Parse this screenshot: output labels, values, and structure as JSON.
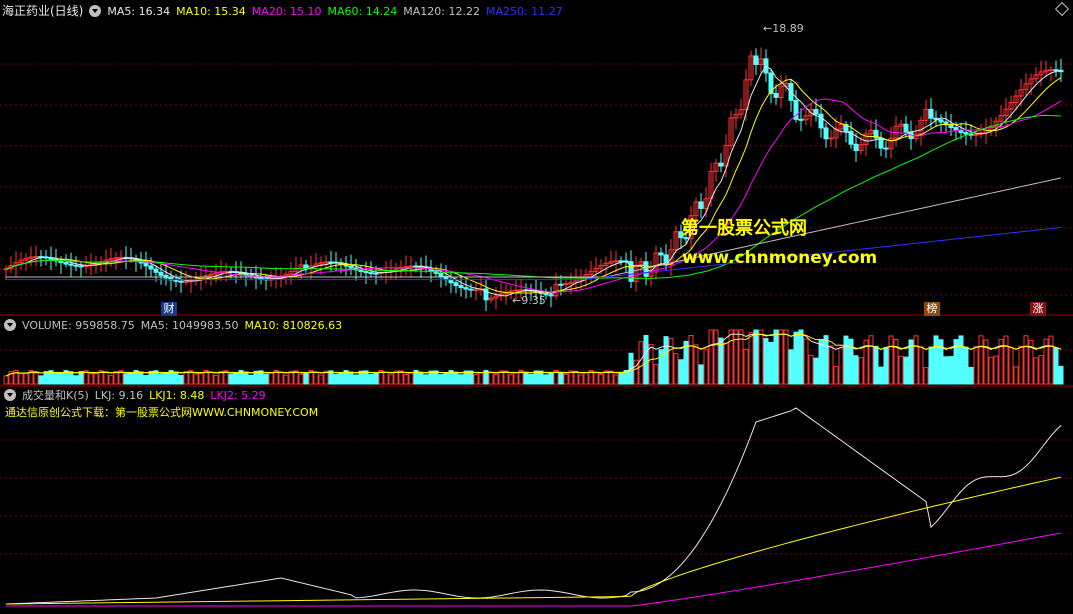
{
  "main_panel": {
    "title": "海正药业(日线)",
    "indicators": [
      {
        "label": "MA5: 16.34",
        "color": "#e8e8e8"
      },
      {
        "label": "MA10: 15.34",
        "color": "#ffff00"
      },
      {
        "label": "MA20: 15.10",
        "color": "#ff00ff"
      },
      {
        "label": "MA60: 14.24",
        "color": "#00ff00"
      },
      {
        "label": "MA120: 12.22",
        "color": "#c0c0c0"
      },
      {
        "label": "MA250: 11.27",
        "color": "#3030ff"
      }
    ],
    "high_label": "18.89",
    "low_label": "9.35",
    "watermark_cn": "第一股票公式网",
    "watermark_url": "www.chnmoney.com",
    "badges": [
      "财",
      "榜",
      "涨"
    ]
  },
  "volume_panel": {
    "indicators": [
      {
        "label": "VOLUME: 959858.75",
        "color": "#c0c0c0"
      },
      {
        "label": "MA5: 1049983.50",
        "color": "#c0c0c0"
      },
      {
        "label": "MA10: 810826.63",
        "color": "#ffff00"
      }
    ]
  },
  "indicator_panel": {
    "indicators": [
      {
        "label": "成交量和K(5)",
        "color": "#c0c0c0"
      },
      {
        "label": "LKJ: 9.16",
        "color": "#c0c0c0"
      },
      {
        "label": "LKJ1: 8.48",
        "color": "#ffff00"
      },
      {
        "label": "LKJ2: 5.29",
        "color": "#ff00ff"
      }
    ],
    "note": "通达信原创公式下载：第一股票公式网WWW.CHNMONEY.COM"
  },
  "colors": {
    "up": "#ff3232",
    "down": "#54ffff",
    "grid": "#800000",
    "axis": "#a00000"
  }
}
